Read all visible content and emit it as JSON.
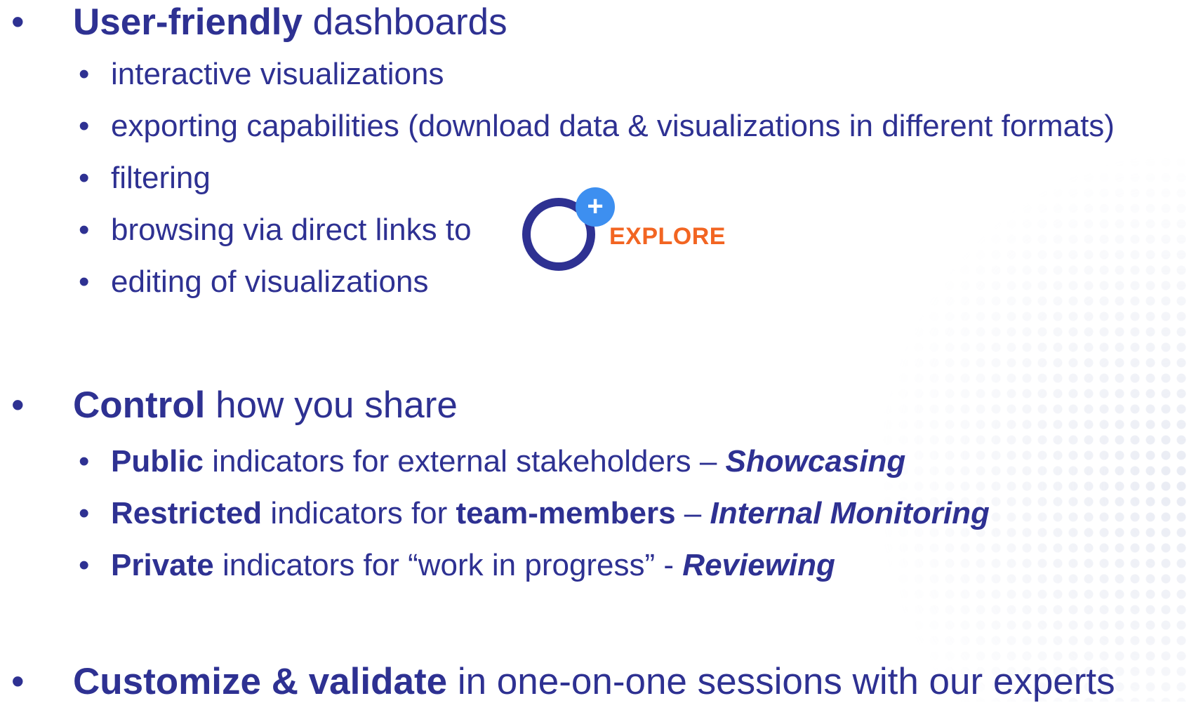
{
  "bullet_symbol": "•",
  "sections": [
    {
      "heading_bold": "User-friendly",
      "heading_rest": " dashboards",
      "items": [
        "interactive visualizations",
        "exporting capabilities (download data & visualizations in different formats)",
        "filtering",
        "browsing via direct links to",
        "editing of visualizations"
      ]
    },
    {
      "heading_bold": "Control",
      "heading_rest": " how you share",
      "items": [
        {
          "bold": "Public",
          "text": " indicators for external stakeholders – ",
          "italic_bold": "Showcasing"
        },
        {
          "bold": "Restricted",
          "text": " indicators for ",
          "bold2": "team-members",
          "text2": " – ",
          "italic_bold": "Internal Monitoring"
        },
        {
          "bold": "Private",
          "text": " indicators for “work in progress” - ",
          "italic_bold": "Reviewing"
        }
      ]
    },
    {
      "heading_bold": "Customize & validate",
      "heading_rest": " in one-on-one sessions with our experts"
    }
  ],
  "explore_logo": {
    "word": "EXPLORE",
    "plus": "+",
    "icon": "plus-circle-ring-icon",
    "colors": {
      "ring": "#2e3192",
      "plus_badge": "#3d8ff0",
      "word": "#f26522"
    }
  },
  "colors": {
    "text": "#2e3192",
    "background": "#ffffff"
  }
}
